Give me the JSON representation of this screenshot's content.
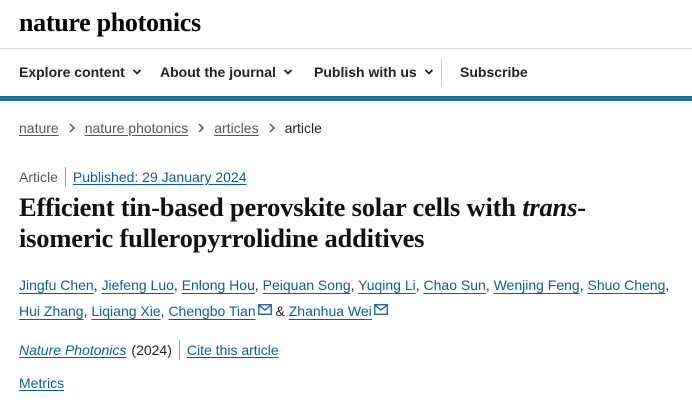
{
  "site": {
    "brand": "nature photonics"
  },
  "nav": {
    "items": [
      {
        "label": "Explore content"
      },
      {
        "label": "About the journal"
      },
      {
        "label": "Publish with us"
      }
    ],
    "subscribe": "Subscribe"
  },
  "breadcrumb": [
    "nature",
    "nature photonics",
    "articles",
    "article"
  ],
  "article": {
    "type": "Article",
    "published": "Published: 29 January 2024",
    "title_before": "Efficient tin-based perovskite solar cells with ",
    "title_italic": "trans",
    "title_after": "-isomeric fulleropyrrolidine additives",
    "authors": [
      "Jingfu Chen",
      "Jiefeng Luo",
      "Enlong Hou",
      "Peiquan Song",
      "Yuqing Li",
      "Chao Sun",
      "Wenjing Feng",
      "Shuo Cheng",
      "Hui Zhang",
      "Liqiang Xie",
      "Chengbo Tian",
      "Zhanhua Wei"
    ],
    "journal": "Nature Photonics",
    "year": "(2024)",
    "cite": "Cite this article",
    "metrics": "Metrics"
  },
  "colors": {
    "link": "#0b5d9c",
    "accent_bar": "#1e6ea7"
  },
  "icons": {
    "nav_dropdown": "chevron-down-icon",
    "breadcrumb_separator": "chevron-right-icon",
    "corresponding_author": "mail-icon"
  }
}
